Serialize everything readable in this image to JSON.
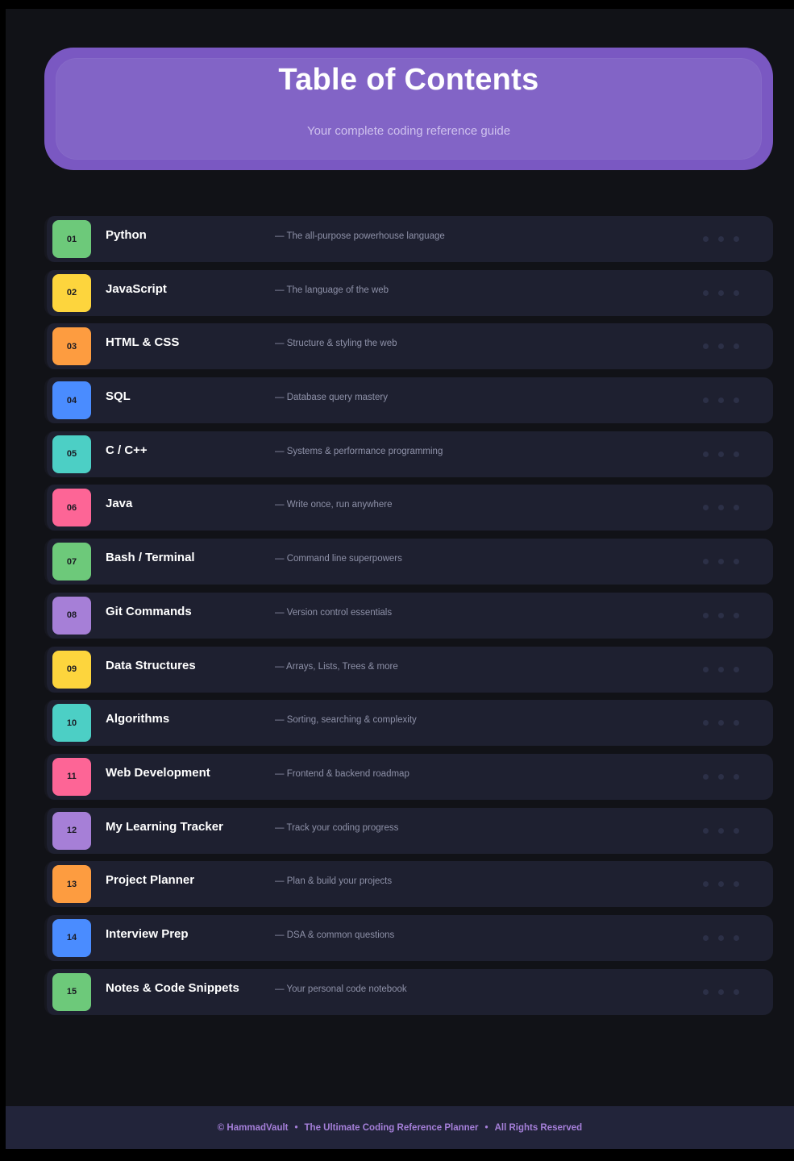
{
  "header": {
    "title": "Table of Contents",
    "subtitle": "Your complete coding reference guide"
  },
  "items": [
    {
      "num": "01",
      "title": "Python",
      "desc": "— The all-purpose powerhouse language",
      "color": "#6dc97a"
    },
    {
      "num": "02",
      "title": "JavaScript",
      "desc": "— The language of the web",
      "color": "#fdd53d"
    },
    {
      "num": "03",
      "title": "HTML & CSS",
      "desc": "— Structure & styling the web",
      "color": "#fd9c40"
    },
    {
      "num": "04",
      "title": "SQL",
      "desc": "— Database query mastery",
      "color": "#4a8cff"
    },
    {
      "num": "05",
      "title": "C / C++",
      "desc": "— Systems & performance programming",
      "color": "#4ccfc5"
    },
    {
      "num": "06",
      "title": "Java",
      "desc": "— Write once, run anywhere",
      "color": "#fd6596"
    },
    {
      "num": "07",
      "title": "Bash / Terminal",
      "desc": "— Command line superpowers",
      "color": "#6dc97a"
    },
    {
      "num": "08",
      "title": "Git Commands",
      "desc": "— Version control essentials",
      "color": "#a67fd7"
    },
    {
      "num": "09",
      "title": "Data Structures",
      "desc": "— Arrays, Lists, Trees & more",
      "color": "#fdd53d"
    },
    {
      "num": "10",
      "title": "Algorithms",
      "desc": "— Sorting, searching & complexity",
      "color": "#4ccfc5"
    },
    {
      "num": "11",
      "title": "Web Development",
      "desc": "— Frontend & backend roadmap",
      "color": "#fd6596"
    },
    {
      "num": "12",
      "title": "My Learning Tracker",
      "desc": "— Track your coding progress",
      "color": "#a67fd7"
    },
    {
      "num": "13",
      "title": "Project Planner",
      "desc": "— Plan & build your projects",
      "color": "#fd9c40"
    },
    {
      "num": "14",
      "title": "Interview Prep",
      "desc": "— DSA & common questions",
      "color": "#4a8cff"
    },
    {
      "num": "15",
      "title": "Notes & Code Snippets",
      "desc": "— Your personal code notebook",
      "color": "#6dc97a"
    }
  ],
  "footer": {
    "copyright": "© HammadVault",
    "product": "The Ultimate Coding Reference Planner",
    "rights": "All Rights Reserved",
    "separator": "•"
  }
}
